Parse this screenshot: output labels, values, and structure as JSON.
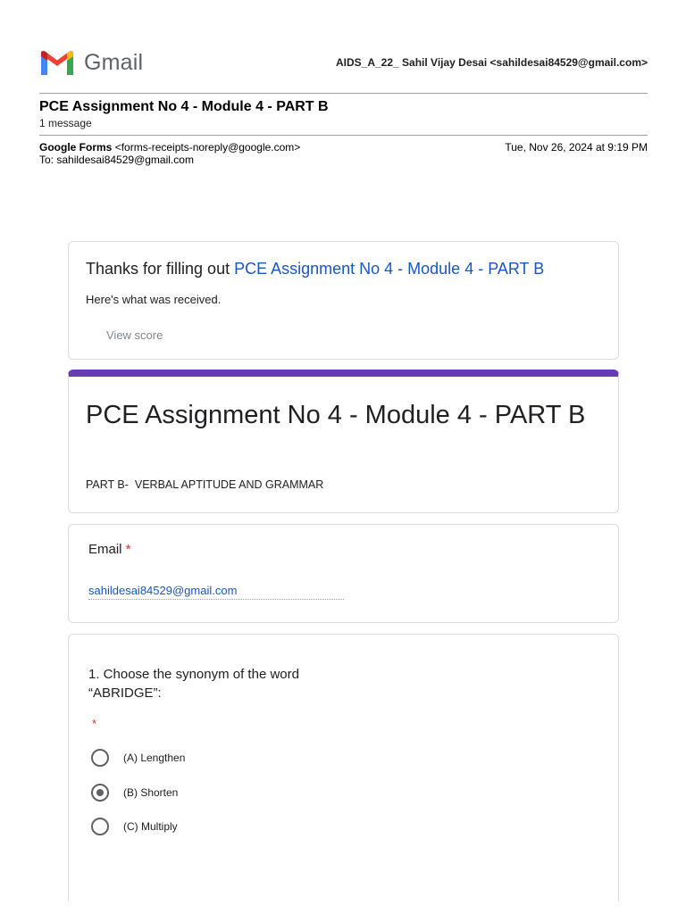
{
  "gmail": {
    "wordmark": "Gmail",
    "logo_icon": "gmail-m-logo",
    "account": "AIDS_A_22_ Sahil Vijay Desai <sahildesai84529@gmail.com>"
  },
  "thread": {
    "subject": "PCE Assignment No 4 - Module 4 - PART B",
    "message_count": "1 message"
  },
  "message": {
    "from_name": "Google Forms",
    "from_email": "<forms-receipts-noreply@google.com>",
    "to": "To: sahildesai84529@gmail.com",
    "date": "Tue, Nov 26, 2024 at 9:19 PM"
  },
  "receipt": {
    "thanks_prefix": "Thanks for filling out ",
    "form_link": "PCE Assignment No 4 - Module 4 - PART B",
    "received_text": "Here's what was received.",
    "view_score": "View score"
  },
  "form": {
    "title": "PCE Assignment No 4 - Module 4 - PART B",
    "description": "PART B-  VERBAL APTITUDE AND GRAMMAR",
    "accent_color": "#673ab7",
    "email": {
      "label": "Email",
      "required_mark": "*",
      "value": "sahildesai84529@gmail.com"
    },
    "question1": {
      "text_line1": "1. Choose the synonym of the word",
      "text_line2": "“ABRIDGE”:",
      "required_mark": "*",
      "options": [
        {
          "label": "(A) Lengthen",
          "selected": false
        },
        {
          "label": "(B) Shorten",
          "selected": true
        },
        {
          "label": "(C) Multiply",
          "selected": false
        }
      ]
    }
  }
}
